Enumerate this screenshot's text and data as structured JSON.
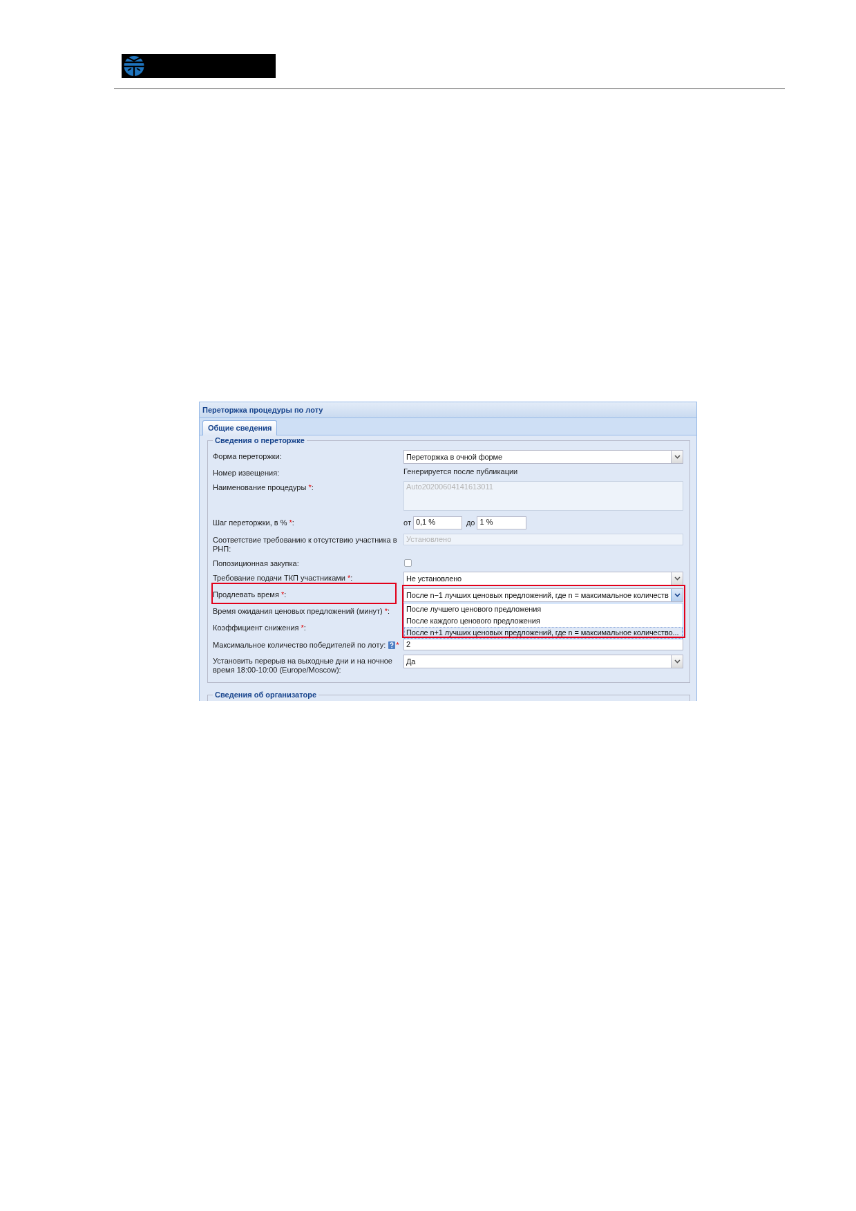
{
  "panel": {
    "title": "Переторжка процедуры по лоту"
  },
  "tabs": [
    {
      "label": "Общие сведения",
      "selected": true
    }
  ],
  "sections": [
    {
      "title": "Сведения о переторжке",
      "fields": [
        {
          "kind": "combo",
          "label": "Форма переторжки:",
          "value": "Переторжка в очной форме",
          "expanded": false,
          "highlighted": false
        },
        {
          "kind": "static",
          "label": "Номер извещения:",
          "value": "Генерируется после публикации",
          "highlighted": false
        },
        {
          "kind": "textarea",
          "label": "Наименование процедуры",
          "required_mark": "*",
          "label_end": ":",
          "value": "Auto20200604141613011",
          "disabled": true,
          "highlighted": false
        },
        {
          "kind": "range",
          "label": "Шаг переторжки, в %",
          "required_mark": "*",
          "label_end": ":",
          "from": {
            "label": "от",
            "value": "0,1 %"
          },
          "to": {
            "label": "до",
            "value": "1 %"
          },
          "highlighted": false
        },
        {
          "kind": "text",
          "label": "Соответствие требованию к отсутствию участника в РНП:",
          "value": "Установлено",
          "disabled": true,
          "highlighted": false
        },
        {
          "kind": "checkbox",
          "label": "Попозиционная закупка:",
          "checked": false,
          "highlighted": false
        },
        {
          "kind": "combo",
          "label": "Требование подачи ТКП участниками",
          "required_mark": "*",
          "label_end": ":",
          "value": "Не установлено",
          "expanded": false,
          "highlighted": false
        },
        {
          "kind": "combo",
          "label": "Продлевать время",
          "required_mark": "*",
          "label_end": ":",
          "value": "После n−1 лучших ценовых предложений, где n = максимальное количеств",
          "expanded": true,
          "highlighted": true,
          "options": [
            {
              "label": "После лучшего ценового предложения",
              "selected": false
            },
            {
              "label": "После каждого ценового предложения",
              "selected": false
            },
            {
              "label": "После n+1 лучших ценовых предложений, где n = максимальное количество...",
              "selected": true
            }
          ]
        },
        {
          "kind": "covered",
          "label": "Время ожидания ценовых предложений (минут)",
          "required_mark": "*",
          "label_end": ":",
          "highlighted": false
        },
        {
          "kind": "covered",
          "label": "Коэффициент снижения",
          "required_mark": "*",
          "label_end": ":",
          "highlighted": false
        },
        {
          "kind": "text",
          "label": "Максимальное количество победителей по лоту:",
          "help": true,
          "required_mark": "*",
          "value": "2",
          "disabled": false,
          "highlighted": false
        },
        {
          "kind": "combo",
          "label": "Установить перерыв на выходные дни и на ночное время 18:00-10:00 (Europe/Moscow):",
          "value": "Да",
          "expanded": false,
          "highlighted": false
        }
      ]
    },
    {
      "title": "Сведения об организаторе"
    }
  ]
}
